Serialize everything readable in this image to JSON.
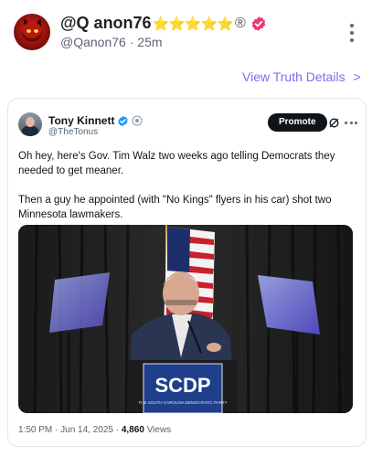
{
  "post": {
    "display_name": "@Q anon76",
    "stars": "⭐⭐⭐⭐⭐",
    "registered_mark": "®",
    "handle": "@Qanon76",
    "separator": "·",
    "time_ago": "25m",
    "view_details_label": "View Truth Details",
    "view_details_chevron": ">"
  },
  "embed": {
    "author_name": "Tony Kinnett",
    "author_handle": "@TheTonus",
    "promote_label": "Promote",
    "text_paragraphs": [
      "Oh hey, here's Gov. Tim Walz two weeks ago telling Democrats they needed to get meaner.",
      "Then a guy he appointed (with \"No Kings\" flyers in his car) shot two Minnesota lawmakers."
    ],
    "timestamp": "1:50 PM · Jun 14, 2025",
    "meta_separator": "·",
    "views_count": "4,860",
    "views_label": "Views",
    "video": {
      "podium_sign": "SCDP",
      "podium_subtext": "THE SOUTH CAROLINA DEMOCRATIC PARTY"
    }
  },
  "colors": {
    "accent_link": "#7b6cf3",
    "verified_pink": "#e8386e",
    "twitter_blue": "#1d9bf0",
    "promote_bg": "#0f1419",
    "podium_blue": "#1f3f8c"
  },
  "icons": [
    "avatar-devil",
    "verified-badge-icon",
    "more-vertical-icon",
    "chevron-right-icon",
    "blue-check-icon",
    "gov-badge-icon",
    "grok-icon",
    "more-horizontal-icon"
  ]
}
